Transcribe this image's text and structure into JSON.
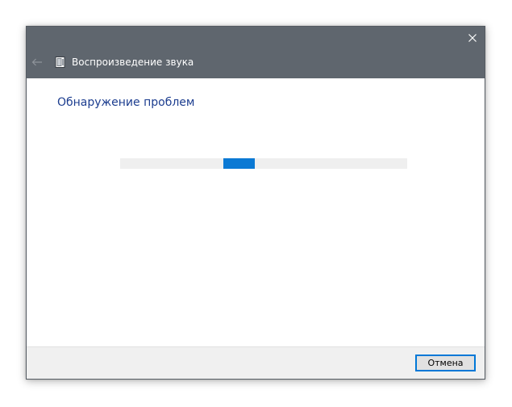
{
  "window": {
    "title": "Воспроизведение звука",
    "close_icon": "close-icon",
    "back_icon": "back-arrow-icon",
    "app_icon": "troubleshooter-icon"
  },
  "content": {
    "heading": "Обнаружение проблем",
    "progress": {
      "indeterminate": true,
      "fill_fraction": 0.11,
      "fill_start_fraction": 0.36
    }
  },
  "footer": {
    "cancel_label": "Отмена"
  },
  "colors": {
    "titlebar": "#5f666e",
    "heading": "#1c3d8f",
    "progress_track": "#efefef",
    "progress_fill": "#0b79d4",
    "button_border": "#0078d7",
    "footer": "#f0f0f0"
  }
}
